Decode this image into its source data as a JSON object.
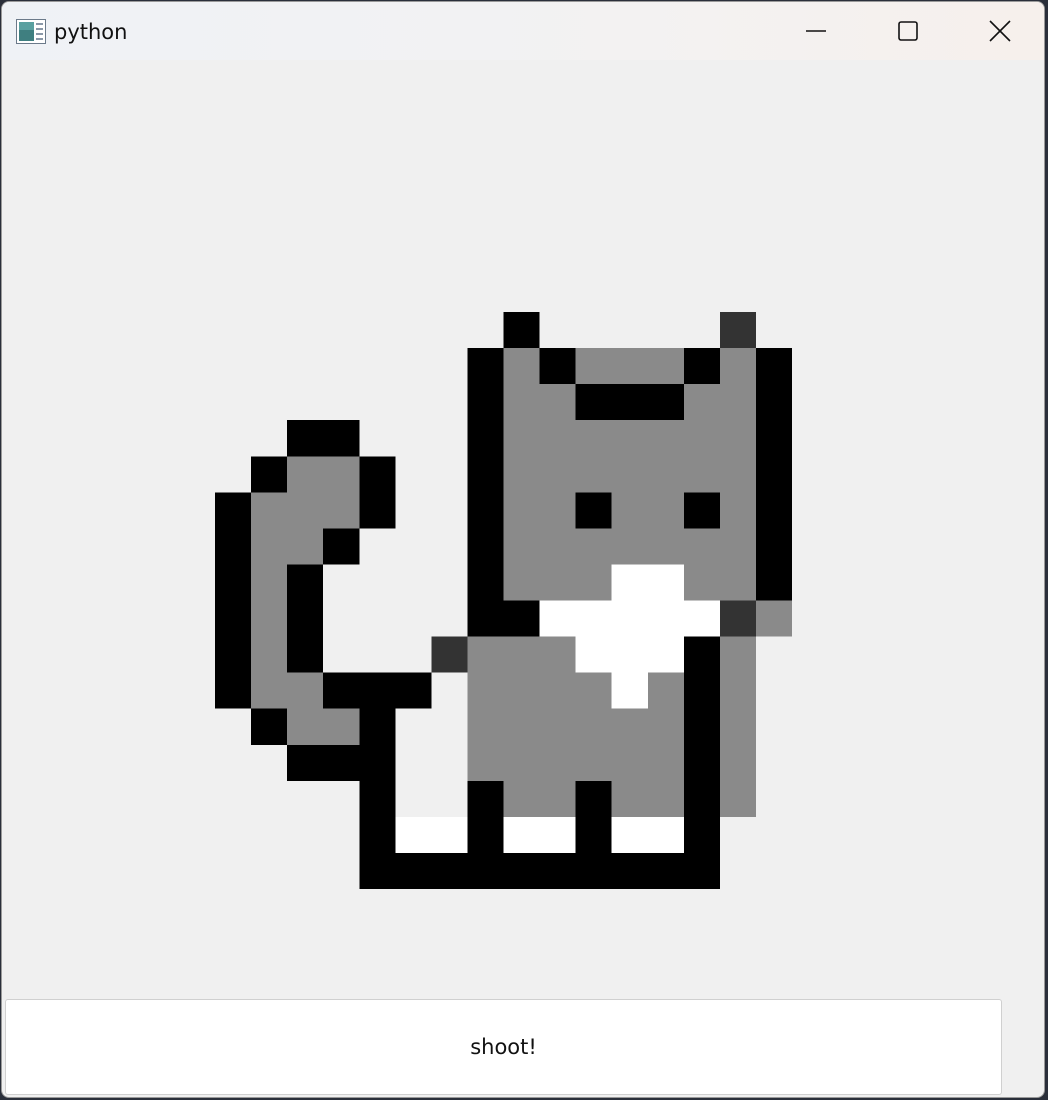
{
  "window": {
    "title": "python",
    "icon": "python-app-icon",
    "controls": [
      "minimize-icon",
      "maximize-icon",
      "close-icon"
    ]
  },
  "image": {
    "subject": "pixel-cat",
    "colors": {
      "outline": "#000000",
      "fur": "#8a8a8a",
      "white": "#ffffff",
      "background": "#f0f0f0"
    }
  },
  "button": {
    "label": "shoot!"
  }
}
